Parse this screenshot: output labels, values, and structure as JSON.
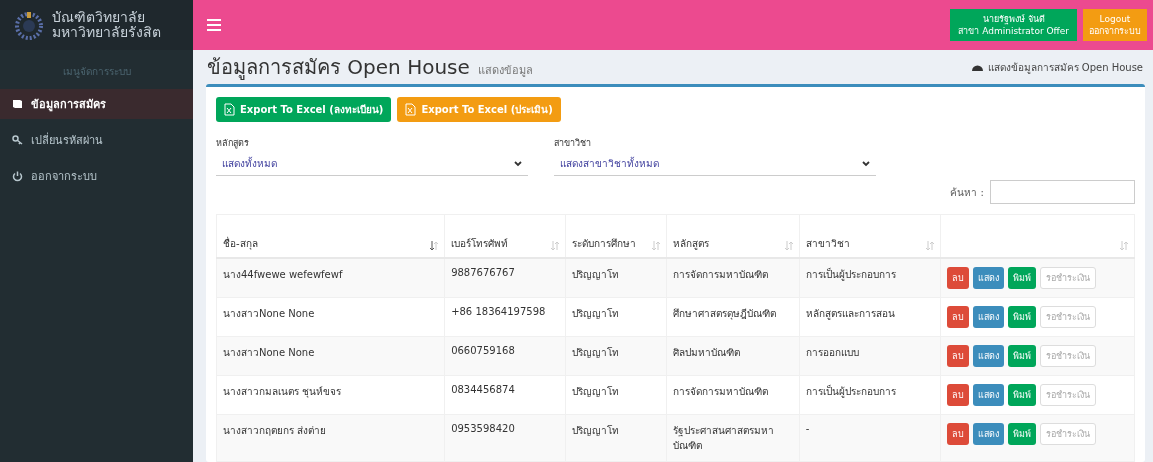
{
  "brand": {
    "line_1": "บัณฑิตวิทยาลัย",
    "line_2": "มหาวิทยาลัยรังสิต"
  },
  "topbar": {
    "user": {
      "name": "นายรัฐพงษ์ จันดี",
      "role": "สาขา Administrator Offer"
    },
    "logout": {
      "label": "Logout",
      "sublabel": "ออกจากระบบ"
    }
  },
  "sidebar": {
    "header": "เมนูจัดการระบบ",
    "items": [
      {
        "label": "ข้อมูลการสมัคร",
        "kind": "book",
        "selected": true
      },
      {
        "label": "เปลี่ยนรหัสผ่าน",
        "kind": "key",
        "selected": false
      },
      {
        "label": "ออกจากระบบ",
        "kind": "power",
        "selected": false
      }
    ]
  },
  "page": {
    "title": "ข้อมูลการสมัคร Open House",
    "subtitle": "แสดงข้อมูล",
    "breadcrumb": "แสดงข้อมูลการสมัคร Open House"
  },
  "export_buttons": [
    {
      "label": "Export To Excel (ลงทะเบียน)",
      "color": "#00a65a"
    },
    {
      "label": "Export To Excel (ประเมิน)",
      "color": "#f39c12"
    }
  ],
  "filters": [
    {
      "label": "หลักสูตร",
      "value": "แสดงทั้งหมด"
    },
    {
      "label": "สาขาวิชา",
      "value": "แสดงสาขาวิชาทั้งหมด"
    }
  ],
  "search": {
    "label": "ค้นหา :"
  },
  "table": {
    "columns": [
      {
        "label": "ชื่อ-สกุล",
        "sorted": true
      },
      {
        "label": "เบอร์โทรศัพท์",
        "sorted": false
      },
      {
        "label": "ระดับการศึกษา",
        "sorted": false
      },
      {
        "label": "หลักสูตร",
        "sorted": false
      },
      {
        "label": "สาขาวิชา",
        "sorted": false
      },
      {
        "sorted": false
      }
    ],
    "rows": [
      {
        "cells": [
          "นาง44fwewe wefewfewf",
          "9887676767",
          "ปริญญาโท",
          "การจัดการมหาบัณฑิต",
          "การเป็นผู้ประกอบการ"
        ],
        "actions": [
          "ลบ",
          "แสดง",
          "พิมพ์",
          "รอชำระเงิน"
        ]
      },
      {
        "cells": [
          "นางสาวNone None",
          "+86 18364197598",
          "ปริญญาโท",
          "ศึกษาศาสตรดุษฎีบัณฑิต",
          "หลักสูตรและการสอน"
        ],
        "actions": [
          "ลบ",
          "แสดง",
          "พิมพ์",
          "รอชำระเงิน"
        ]
      },
      {
        "cells": [
          "นางสาวNone None",
          "0660759168",
          "ปริญญาโท",
          "ศิลปมหาบัณฑิต",
          "การออกแบบ"
        ],
        "actions": [
          "ลบ",
          "แสดง",
          "พิมพ์",
          "รอชำระเงิน"
        ]
      },
      {
        "cells": [
          "นางสาวกมลเนตร ชุนห์ขจร",
          "0834456874",
          "ปริญญาโท",
          "การจัดการมหาบัณฑิต",
          "การเป็นผู้ประกอบการ"
        ],
        "actions": [
          "ลบ",
          "แสดง",
          "พิมพ์",
          "รอชำระเงิน"
        ]
      },
      {
        "cells": [
          "นางสาวกฤตยกร ส่งต่าย",
          "0953598420",
          "ปริญญาโท",
          "รัฐประศาสนศาสตรมหาบัณฑิต",
          "-"
        ],
        "actions": [
          "ลบ",
          "แสดง",
          "พิมพ์",
          "รอชำระเงิน"
        ]
      }
    ]
  }
}
